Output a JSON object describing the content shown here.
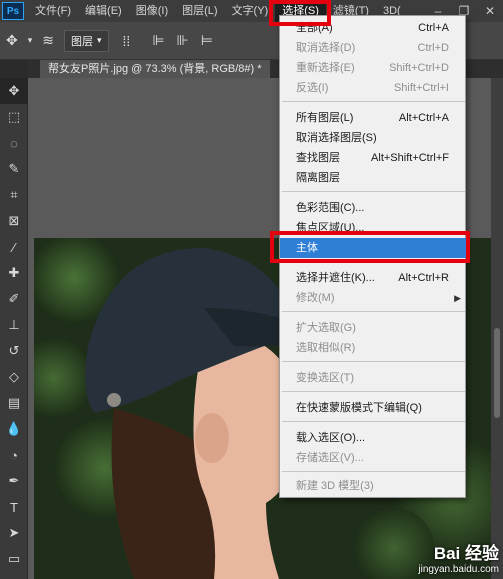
{
  "app": {
    "logo": "Ps"
  },
  "menubar": {
    "items": [
      "文件(F)",
      "编辑(E)",
      "图像(I)",
      "图层(L)",
      "文字(Y)",
      "选择(S)",
      "滤镜(T)",
      "3D("
    ],
    "active": "选择(S)",
    "window_controls": [
      "minimize-icon",
      "restore-icon",
      "close-icon"
    ]
  },
  "options_bar": {
    "layer_select": "图层",
    "icons": [
      "move-icon",
      "chevron-down-icon",
      "layer-stack-icon",
      "transform-grid-icon",
      "align-left-icon",
      "align-center-icon",
      "align-right-icon"
    ]
  },
  "document_tab": {
    "title": "帮女友P照片.jpg @ 73.3% (背景, RGB/8#) *",
    "close": "×"
  },
  "select_menu": {
    "sections": [
      [
        {
          "label": "全部(A)",
          "shortcut": "Ctrl+A",
          "enabled": true
        },
        {
          "label": "取消选择(D)",
          "shortcut": "Ctrl+D",
          "enabled": false
        },
        {
          "label": "重新选择(E)",
          "shortcut": "Shift+Ctrl+D",
          "enabled": false
        },
        {
          "label": "反选(I)",
          "shortcut": "Shift+Ctrl+I",
          "enabled": false
        }
      ],
      [
        {
          "label": "所有图层(L)",
          "shortcut": "Alt+Ctrl+A",
          "enabled": true
        },
        {
          "label": "取消选择图层(S)",
          "shortcut": "",
          "enabled": true
        },
        {
          "label": "查找图层",
          "shortcut": "Alt+Shift+Ctrl+F",
          "enabled": true
        },
        {
          "label": "隔离图层",
          "shortcut": "",
          "enabled": true
        }
      ],
      [
        {
          "label": "色彩范围(C)...",
          "shortcut": "",
          "enabled": true
        },
        {
          "label": "焦点区域(U)...",
          "shortcut": "",
          "enabled": true
        },
        {
          "label": "主体",
          "shortcut": "",
          "enabled": true,
          "highlighted": true
        }
      ],
      [
        {
          "label": "选择并遮住(K)...",
          "shortcut": "Alt+Ctrl+R",
          "enabled": true
        },
        {
          "label": "修改(M)",
          "shortcut": "",
          "enabled": false,
          "submenu": true
        }
      ],
      [
        {
          "label": "扩大选取(G)",
          "shortcut": "",
          "enabled": false
        },
        {
          "label": "选取相似(R)",
          "shortcut": "",
          "enabled": false
        }
      ],
      [
        {
          "label": "变换选区(T)",
          "shortcut": "",
          "enabled": false
        }
      ],
      [
        {
          "label": "在快速蒙版模式下编辑(Q)",
          "shortcut": "",
          "enabled": true
        }
      ],
      [
        {
          "label": "载入选区(O)...",
          "shortcut": "",
          "enabled": true
        },
        {
          "label": "存储选区(V)...",
          "shortcut": "",
          "enabled": false
        }
      ],
      [
        {
          "label": "新建 3D 模型(3)",
          "shortcut": "",
          "enabled": false
        }
      ]
    ]
  },
  "toolbar": {
    "tools": [
      "move-icon",
      "marquee-icon",
      "lasso-icon",
      "quick-select-icon",
      "crop-icon",
      "frame-icon",
      "eyedropper-icon",
      "healing-icon",
      "brush-icon",
      "stamp-icon",
      "history-brush-icon",
      "eraser-icon",
      "gradient-icon",
      "blur-icon",
      "dodge-icon",
      "pen-icon",
      "type-icon",
      "path-select-icon",
      "rectangle-icon",
      "hand-icon"
    ]
  },
  "watermark": {
    "brand": "Bai 经验",
    "url": "jingyan.baidu.com"
  },
  "colors": {
    "highlight": "#2f7fd6",
    "annotation": "#e4000f",
    "menu_bg": "#f0f0f0"
  }
}
